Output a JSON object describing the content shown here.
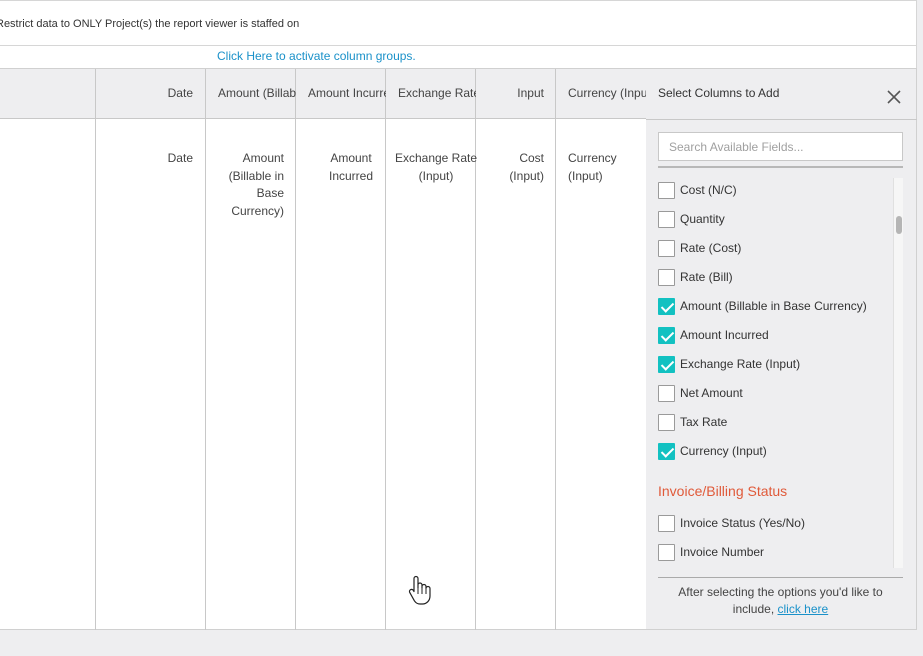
{
  "restrict_text": "Restrict data to ONLY Project(s) the report viewer is staffed on",
  "activate_link": "Click Here to activate column groups.",
  "columns": [
    {
      "header": "Date",
      "body": "Date",
      "align": "right"
    },
    {
      "header": "Amount (Billable in Base Currency)",
      "body": "Amount (Billable in Base Currency)",
      "align": "right"
    },
    {
      "header": "Amount Incurred",
      "body": "Amount Incurred",
      "align": "center"
    },
    {
      "header": "Exchange Rate (Input)",
      "body": "Exchange Rate (Input)",
      "align": "center"
    },
    {
      "header": "Input",
      "body": "Cost (Input)",
      "align": "right"
    },
    {
      "header": "Currency (Input)",
      "body": "Currency (Input)",
      "align": "left"
    }
  ],
  "panel": {
    "title": "Select Columns to Add",
    "search_placeholder": "Search Available Fields...",
    "items": [
      {
        "label": "Cost (N/C)",
        "checked": false
      },
      {
        "label": "Quantity",
        "checked": false
      },
      {
        "label": "Rate (Cost)",
        "checked": false
      },
      {
        "label": "Rate (Bill)",
        "checked": false
      },
      {
        "label": "Amount (Billable in Base Currency)",
        "checked": true
      },
      {
        "label": "Amount Incurred",
        "checked": true
      },
      {
        "label": "Exchange Rate (Input)",
        "checked": true
      },
      {
        "label": "Net Amount",
        "checked": false
      },
      {
        "label": "Tax Rate",
        "checked": false
      },
      {
        "label": "Currency (Input)",
        "checked": true
      }
    ],
    "section_title": "Invoice/Billing Status",
    "section_items": [
      {
        "label": "Invoice Status (Yes/No)",
        "checked": false
      },
      {
        "label": "Invoice Number",
        "checked": false
      }
    ],
    "footer_text": "After selecting the options you'd like to include, ",
    "footer_link": "click here"
  },
  "colors": {
    "accent": "#12c1c1",
    "link": "#1a91c9",
    "section": "#e05a3a"
  }
}
